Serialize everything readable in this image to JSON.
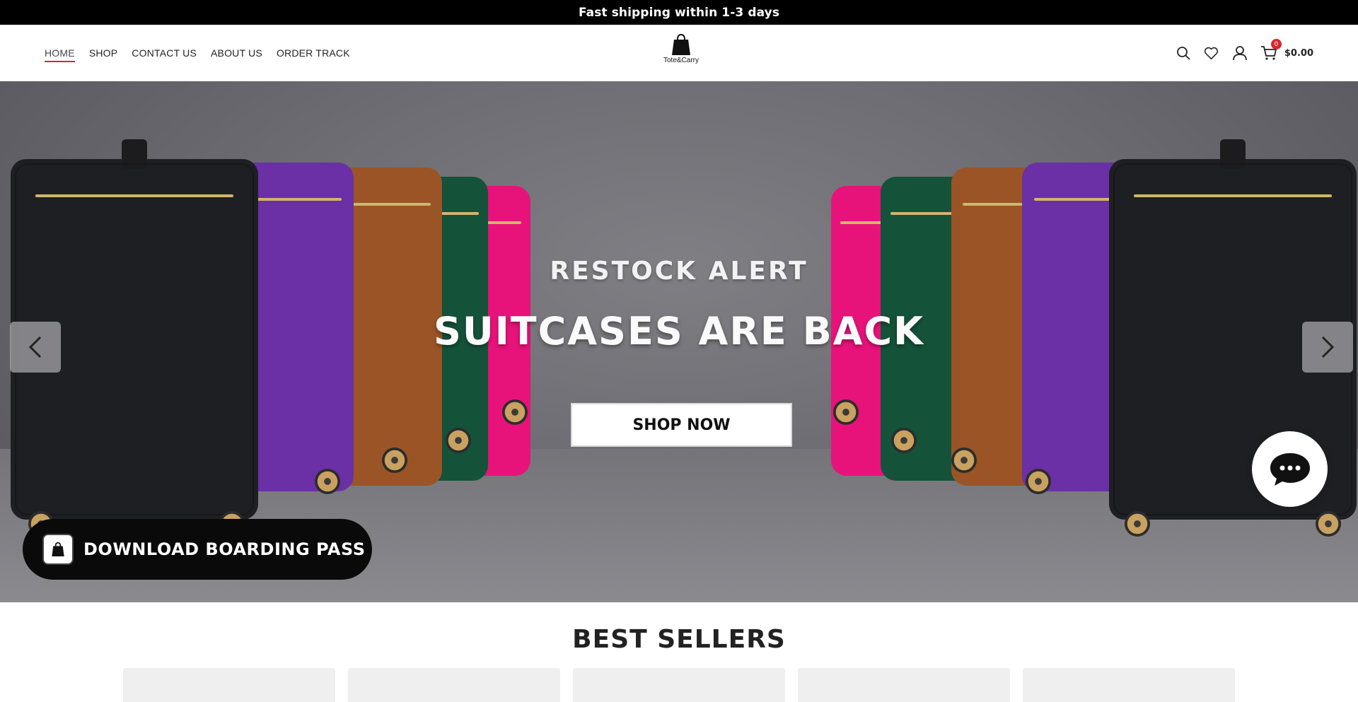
{
  "announcement": "Fast shipping within 1-3 days",
  "nav": {
    "items": [
      {
        "label": "HOME",
        "active": true
      },
      {
        "label": "SHOP",
        "active": false
      },
      {
        "label": "CONTACT US",
        "active": false
      },
      {
        "label": "ABOUT US",
        "active": false
      },
      {
        "label": "ORDER TRACK",
        "active": false
      }
    ]
  },
  "logo": {
    "text": "Tote&Carry"
  },
  "header_icons": [
    "search-icon",
    "heart-icon",
    "user-icon",
    "cart-icon"
  ],
  "cart": {
    "count": "0",
    "total": "$0.00"
  },
  "hero": {
    "kicker": "RESTOCK ALERT",
    "headline": "SUITCASES ARE BACK",
    "cta": "SHOP NOW",
    "prev_icon": "chevron-left-icon",
    "next_icon": "chevron-right-icon"
  },
  "boarding_pass": {
    "label": "DOWNLOAD BOARDING PASS"
  },
  "chat": {
    "icon": "chat-icon"
  },
  "best_sellers": {
    "title": "BEST SELLERS"
  },
  "colors": {
    "accent": "#d9252b",
    "topbar": "#000000",
    "suitcase_black": "#1e1f22",
    "suitcase_purple": "#6b2fa6",
    "suitcase_brown": "#9a5426",
    "suitcase_green": "#14523a",
    "suitcase_pink": "#e8137a"
  }
}
